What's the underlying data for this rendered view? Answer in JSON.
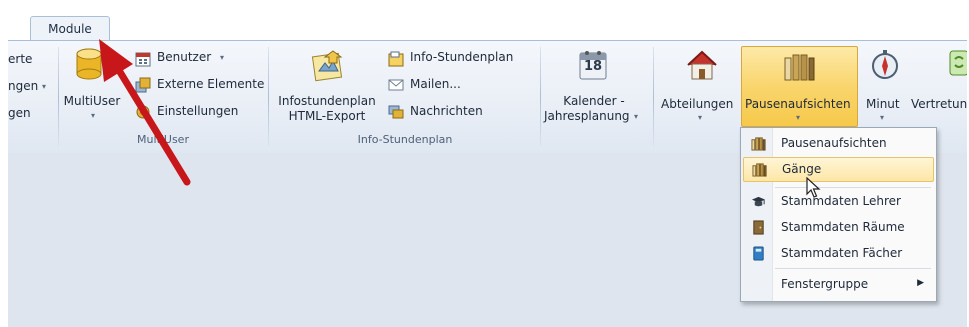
{
  "tab": {
    "label": "Module"
  },
  "ribbon": {
    "left_partial": {
      "line1": "erte",
      "line2": "ngen",
      "line3": "gen"
    },
    "multiuser": {
      "big_label": "MultiUser",
      "small_buttons": [
        "Benutzer",
        "Externe Elemente",
        "Einstellungen"
      ],
      "group_label": "MultiUser"
    },
    "info": {
      "big_label_line1": "Infostundenplan",
      "big_label_line2": "HTML-Export",
      "small_buttons": [
        "Info-Stundenplan",
        "Mailen...",
        "Nachrichten"
      ],
      "group_label": "Info-Stundenplan"
    },
    "kalender": {
      "line1": "Kalender -",
      "line2": "Jahresplanung",
      "day": "18"
    },
    "abteilungen": "Abteilungen",
    "pausenaufsichten": "Pausenaufsichten",
    "minut": "Minut",
    "vertretung": "Vertretung"
  },
  "menu": {
    "items": [
      {
        "label": "Pausenaufsichten",
        "icon": "fence-icon"
      },
      {
        "label": "Gänge",
        "icon": "fence-icon"
      },
      {
        "label": "Stammdaten Lehrer",
        "icon": "graduation-cap-icon"
      },
      {
        "label": "Stammdaten Räume",
        "icon": "door-icon"
      },
      {
        "label": "Stammdaten Fächer",
        "icon": "book-icon"
      },
      {
        "label": "Fenstergruppe",
        "icon": ""
      }
    ]
  },
  "colors": {
    "accent": "#f6c94a",
    "arrow": "#c8171b"
  }
}
